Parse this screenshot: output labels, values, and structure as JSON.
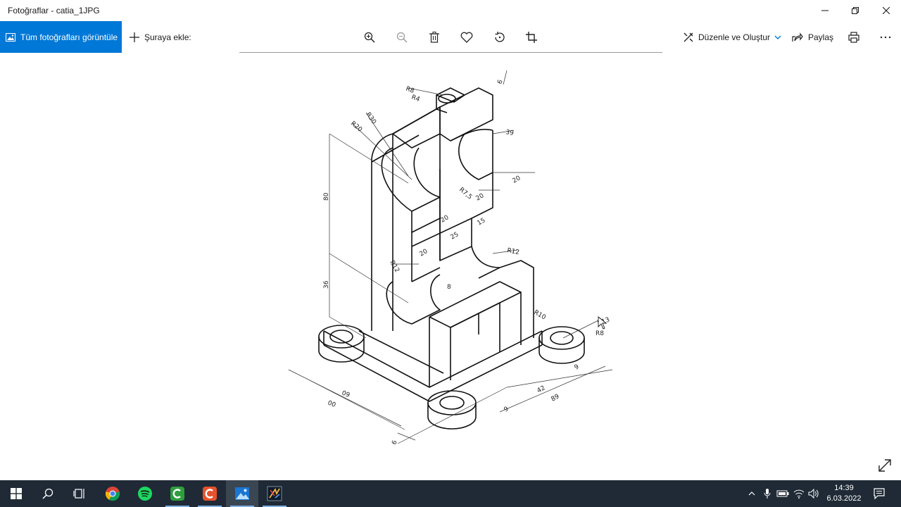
{
  "window": {
    "title": "Fotoğraflar - catia_1JPG"
  },
  "toolbar": {
    "all_photos_label": "Tüm fotoğrafları görüntüle",
    "add_to_label": "Şuraya ekle:",
    "edit_create_label": "Düzenle ve Oluştur",
    "share_label": "Paylaş",
    "tools": [
      "zoom-in-icon",
      "zoom-out-icon",
      "delete-icon",
      "favorite-heart-icon",
      "rotate-icon",
      "crop-icon"
    ]
  },
  "drawing": {
    "dimensions": {
      "r8_top": "R8",
      "r4": "R4",
      "r30": "R30",
      "r20": "R20",
      "d6_top": "6",
      "d39": "39",
      "d20_right": "20",
      "r7_5": "R7,5",
      "d20_mid": "20",
      "d20_slot": "20",
      "d25": "25",
      "d15": "15",
      "d20_lower": "20",
      "r12_right": "R12",
      "r12_left": "R12",
      "d8": "8",
      "h80": "80",
      "h36": "36",
      "r10": "R10",
      "r13": "R13",
      "r8_right": "R8",
      "d60": "60",
      "d00": "00",
      "d9_right": "9",
      "d42": "42",
      "d9_bottom": "9",
      "d89": "89",
      "d6_bottom": "6"
    }
  },
  "taskbar": {
    "apps": [
      "windows-start-icon",
      "search-icon",
      "task-view-icon",
      "chrome-icon",
      "spotify-icon",
      "camtasia-green-icon",
      "camtasia-orange-icon",
      "photos-icon",
      "catia-icon"
    ],
    "active_app": "photos-icon",
    "time": "14:39",
    "date": "6.03.2022"
  },
  "colors": {
    "accent": "#0078d7",
    "taskbar": "#1f2a36",
    "chrome_red": "#db4437",
    "spotify_green": "#1ed760",
    "camtasia_green": "#2e9e3e",
    "camtasia_orange": "#e5532d"
  }
}
